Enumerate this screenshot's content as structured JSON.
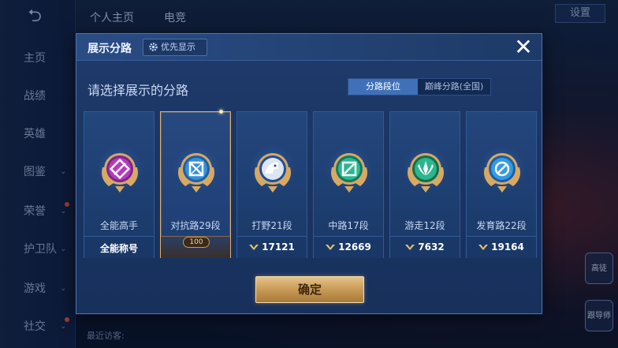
{
  "background": {
    "nav_items": [
      {
        "label": "主页",
        "chevron": false,
        "dot": false
      },
      {
        "label": "战绩",
        "chevron": false,
        "dot": false
      },
      {
        "label": "英雄",
        "chevron": false,
        "dot": false
      },
      {
        "label": "图鉴",
        "chevron": true,
        "dot": false
      },
      {
        "label": "荣誉",
        "chevron": true,
        "dot": true
      },
      {
        "label": "护卫队",
        "chevron": true,
        "dot": false
      },
      {
        "label": "游戏",
        "chevron": true,
        "dot": false
      },
      {
        "label": "社交",
        "chevron": true,
        "dot": true
      }
    ],
    "top_tabs": [
      "个人主页",
      "电竞"
    ],
    "settings_label": "设置",
    "recent_visitors_label": "最近访客:",
    "side_badges": [
      "高徒",
      "跟导师"
    ]
  },
  "modal": {
    "title": "展示分路",
    "priority_button": "优先显示",
    "close_label": "✕",
    "subtitle": "请选择展示的分路",
    "segment": {
      "active": "分路段位",
      "inactive": "巅峰分路(全国)"
    },
    "cards": [
      {
        "name": "全能高手",
        "footer": "全能称号",
        "emblem": "allround",
        "color": "#c43ec8",
        "inner": "#7a2690",
        "selected": false,
        "show_icon": false
      },
      {
        "name": "对抗路29段",
        "footer": "100",
        "emblem": "clash",
        "color": "#3a9ae0",
        "inner": "#1e5fa8",
        "selected": true,
        "show_icon": false
      },
      {
        "name": "打野21段",
        "footer": "17121",
        "emblem": "jungle",
        "color": "#ffffff",
        "inner": "#1f4f9a",
        "selected": false,
        "show_icon": true
      },
      {
        "name": "中路17段",
        "footer": "12669",
        "emblem": "mid",
        "color": "#2fc39a",
        "inner": "#117a60",
        "selected": false,
        "show_icon": true
      },
      {
        "name": "游走12段",
        "footer": "7632",
        "emblem": "roam",
        "color": "#2fc39a",
        "inner": "#0f6e4e",
        "selected": false,
        "show_icon": true
      },
      {
        "name": "发育路22段",
        "footer": "19164",
        "emblem": "farm",
        "color": "#3aa4ee",
        "inner": "#1c5ea6",
        "selected": false,
        "show_icon": true
      }
    ],
    "confirm_label": "确定"
  },
  "colors": {
    "gold": "#d8a962",
    "accent_blue": "#3f70b8"
  }
}
